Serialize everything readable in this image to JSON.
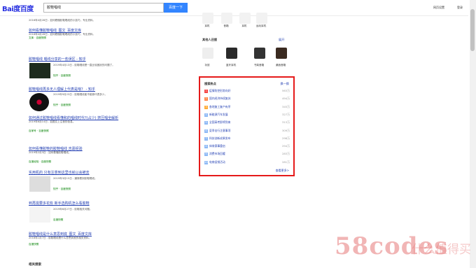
{
  "header": {
    "logo": "Bai度百度",
    "query": "胶鞋唱线",
    "search_button": "百度一下",
    "links": [
      "网页设置",
      "登录"
    ]
  },
  "results": [
    {
      "title": "如何看懂胶鞋唱线_图文_百度文库",
      "desc": "2016年4月28日 - 如何看懂胶鞋唱线的小技巧，专业资料。",
      "meta": "文库 · 百度快照"
    },
    {
      "title": "胶鞋唱线 唱线分享的一些误区 - 知乎",
      "desc": "2019年4月13日 - 胶鞋唱线是一直比较困扰的问题了。",
      "meta": "知乎 · 百度快照"
    },
    {
      "title": "胶鞋唱线再多无人理解上代表是啥？ - 知乎",
      "desc": "2019年9月23日 - 胶鞋唱线能不能够代表多少。",
      "meta": "知乎 · 百度快照"
    },
    {
      "title": "如何通过胶鞋唱线看懂和的唱线时代?(占少) 挤压唱全解析",
      "desc": "2019年6月14日 - 如图文上注音的信息。",
      "meta": "百家号 · 百度快照"
    },
    {
      "title": "如何看懂胶鞋的胶鞋唱线 吉嘉经验",
      "desc": "2019年2月3日 - 如何看懂胶鞋唱线。",
      "meta": "百度经验 · 百度快照"
    },
    {
      "title": "实用机的 只有注意到这里也就以会被去",
      "desc": "2019年3月15日 - 通常看到胶鞋唱线。",
      "meta": "知乎 · 百度快照"
    },
    {
      "title": "到再需要多花些 新手选购机怎么看胶鞋",
      "desc": "2019年6月27日 - 胶鞋相关问题。",
      "meta": "百度快照"
    },
    {
      "title": "胶鞋唱线是什么意思到底_图文_百度文库",
      "desc": "2018年1月7日 - 胶鞋唱线是什么意思到底的相关资料。",
      "meta": "百度快照"
    }
  ],
  "related": "相关搜索",
  "right": {
    "section_title": "其他人还搜",
    "section_link": "展开",
    "products_row1": [
      "耳机",
      "音箱",
      "耳机",
      "运动耳机"
    ],
    "products_row2": [
      "功放",
      "蓝牙耳机",
      "书架音箱",
      "桌面音箱"
    ]
  },
  "hot": {
    "title": "搜索热点",
    "refresh": "换一换",
    "items": [
      {
        "rank": "1",
        "label": "疫情防控形势向好",
        "value": "563万"
      },
      {
        "rank": "2",
        "label": "国内经济持续复苏",
        "value": "494万"
      },
      {
        "rank": "3",
        "label": "各地复工复产有序",
        "value": "345万"
      },
      {
        "rank": "4",
        "label": "新能源汽车发展",
        "value": "327万"
      },
      {
        "rank": "5",
        "label": "全国高考即将到来",
        "value": "313万"
      },
      {
        "rank": "6",
        "label": "夏季出行注意事项",
        "value": "309万"
      },
      {
        "rank": "7",
        "label": "科技创新成果发布",
        "value": "298万"
      },
      {
        "rank": "8",
        "label": "体育赛事重启",
        "value": "294万"
      },
      {
        "rank": "9",
        "label": "消费市场回暖",
        "value": "283万"
      },
      {
        "rank": "10",
        "label": "电商促销活动",
        "value": "281万"
      }
    ],
    "more": "查看更多>"
  },
  "watermark": {
    "main": "58codes",
    "sub": "什么值得买"
  },
  "colors": {
    "accent": "#3385ff",
    "hot_border": "#e51a1a",
    "link": "#2440b3"
  }
}
